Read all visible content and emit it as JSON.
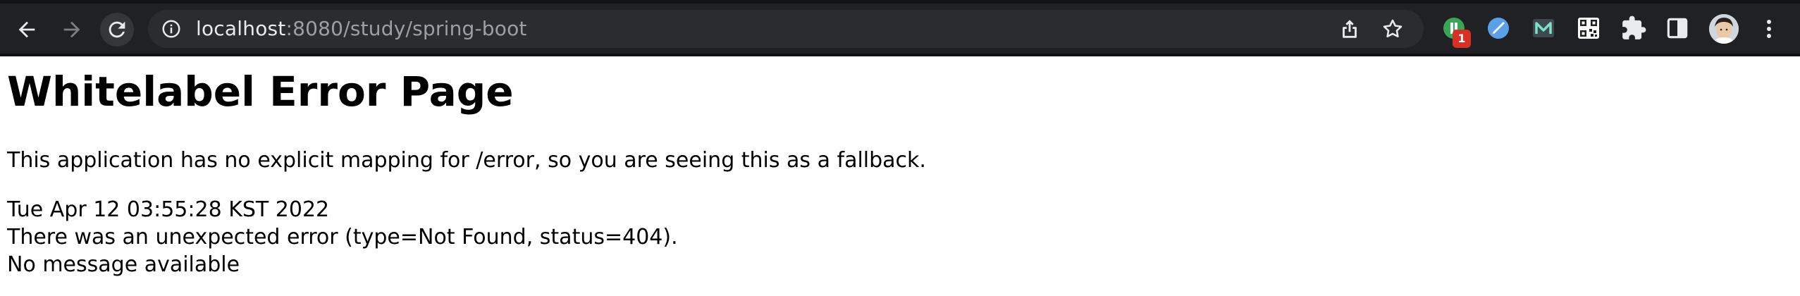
{
  "browser": {
    "url_host": "localhost",
    "url_rest": ":8080/study/spring-boot",
    "extension_badge_count": "1",
    "icons": {
      "back": "back-arrow-icon",
      "forward": "forward-arrow-icon",
      "reload": "reload-icon",
      "site_info": "info-icon",
      "share": "share-icon",
      "bookmark": "star-icon",
      "extensions": "puzzle-icon",
      "side_panel": "side-panel-icon",
      "menu": "kebab-menu-icon"
    },
    "colors": {
      "toolbar_bg": "#202124",
      "omnibox_bg": "#2b2c2f",
      "url_host": "#e8eaed",
      "url_rest": "#9aa0a6",
      "badge": "#d93025"
    }
  },
  "page": {
    "title": "Whitelabel Error Page",
    "paragraph": "This application has no explicit mapping for /error, so you are seeing this as a fallback.",
    "timestamp": "Tue Apr 12 03:55:28 KST 2022",
    "error_line": "There was an unexpected error (type=Not Found, status=404).",
    "message_line": "No message available"
  }
}
